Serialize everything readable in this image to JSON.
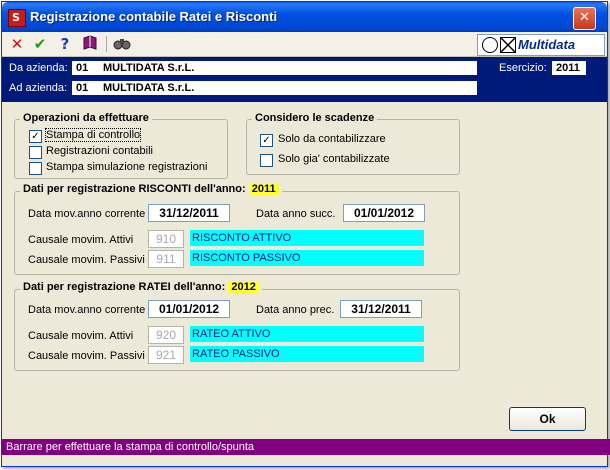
{
  "window": {
    "title": "Registrazione contabile Ratei e Risconti",
    "app_icon_letter": "S"
  },
  "toolbar": {
    "brand": "Multidata"
  },
  "header": {
    "da_label": "Da azienda:",
    "da_code": "01",
    "da_name": "MULTIDATA S.r.L.",
    "ad_label": "Ad azienda:",
    "ad_code": "01",
    "ad_name": "MULTIDATA S.r.L.",
    "esercizio_label": "Esercizio:",
    "esercizio_value": "2011"
  },
  "operazioni": {
    "title": "Operazioni da effettuare",
    "items": [
      {
        "label": "Stampa di controllo",
        "checked": true
      },
      {
        "label": "Registrazioni contabili",
        "checked": false
      },
      {
        "label": "Stampa simulazione registrazioni",
        "checked": false
      }
    ]
  },
  "scadenze": {
    "title": "Considero le scadenze",
    "items": [
      {
        "label": "Solo da contabilizzare",
        "checked": true
      },
      {
        "label": "Solo gia' contabilizzate",
        "checked": false
      }
    ]
  },
  "risconti": {
    "title": "Dati per registrazione RISCONTI dell'anno:",
    "year": "2011",
    "data_mov_label": "Data mov.anno corrente",
    "data_mov_value": "31/12/2011",
    "data_altro_label": "Data anno succ.",
    "data_altro_value": "01/01/2012",
    "attivi_label": "Causale movim. Attivi",
    "attivi_code": "910",
    "attivi_desc": "RISCONTO ATTIVO",
    "passivi_label": "Causale movim. Passivi",
    "passivi_code": "911",
    "passivi_desc": "RISCONTO PASSIVO"
  },
  "ratei": {
    "title": "Dati per registrazione RATEI dell'anno:",
    "year": "2012",
    "data_mov_label": "Data mov.anno corrente",
    "data_mov_value": "01/01/2012",
    "data_altro_label": "Data anno prec.",
    "data_altro_value": "31/12/2011",
    "attivi_label": "Causale movim. Attivi",
    "attivi_code": "920",
    "attivi_desc": "RATEO ATTIVO",
    "passivi_label": "Causale movim. Passivi",
    "passivi_code": "921",
    "passivi_desc": "RATEO PASSIVO"
  },
  "buttons": {
    "ok": "Ok"
  },
  "status": {
    "text": "Barrare per effettuare la stampa di controllo/spunta"
  },
  "colors": {
    "title_blue": "#0050e0",
    "header_band": "#001a7a",
    "cyan": "#00ffff",
    "status": "#800080",
    "highlight": "#ffff33"
  }
}
